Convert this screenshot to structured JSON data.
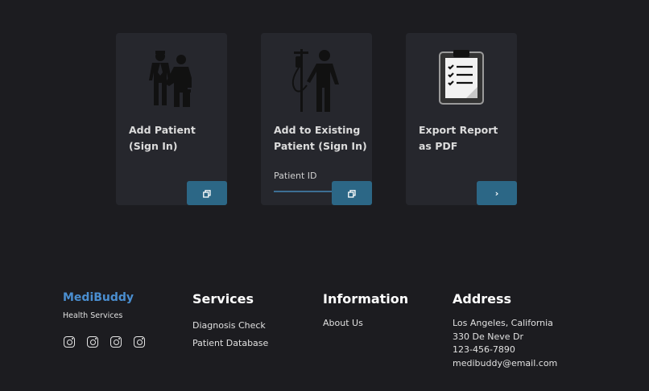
{
  "cards": [
    {
      "title": "Add Patient (Sign In)",
      "button_icon": "copy-icon"
    },
    {
      "title": "Add to Existing Patient (Sign In)",
      "input_label": "Patient ID",
      "button_icon": "copy-icon"
    },
    {
      "title": "Export Report as PDF",
      "button_label": "›"
    }
  ],
  "footer": {
    "brand": "MediBuddy",
    "tagline": "Health Services",
    "social_icons": [
      "instagram-icon",
      "instagram-icon",
      "instagram-icon",
      "instagram-icon"
    ],
    "services": {
      "heading": "Services",
      "items": [
        "Diagnosis Check",
        "Patient Database"
      ]
    },
    "information": {
      "heading": "Information",
      "items": [
        "About Us"
      ]
    },
    "address": {
      "heading": "Address",
      "lines": [
        "Los Angeles, California",
        "330 De Neve Dr",
        "123-456-7890",
        "medibuddy@email.com"
      ]
    }
  },
  "colors": {
    "background": "#1c1c20",
    "card": "#26272d",
    "button": "#2c6786",
    "brand": "#4a8ed0"
  }
}
